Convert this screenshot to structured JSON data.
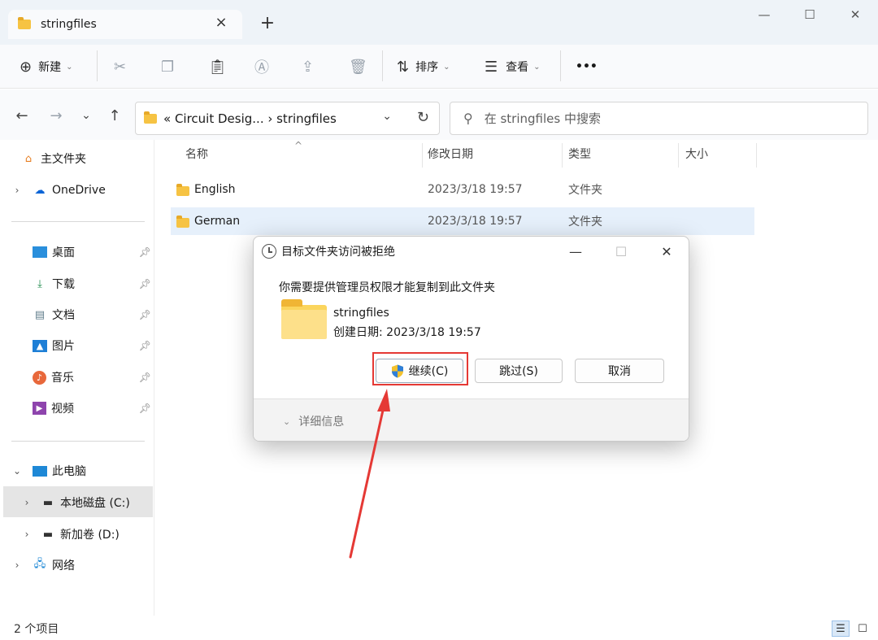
{
  "window": {
    "tab_title": "stringfiles",
    "tab_close": "×",
    "new_tab": "+",
    "controls": {
      "minimize": "—",
      "maximize": "☐",
      "close": "✕"
    }
  },
  "toolbar": {
    "new_label": "新建",
    "sort_label": "排序",
    "view_label": "查看",
    "more": "•••",
    "icons": [
      "new-icon",
      "cut-icon",
      "copy-icon",
      "paste-icon",
      "rename-icon",
      "share-icon",
      "delete-icon",
      "sort-icon",
      "view-icon",
      "more-icon"
    ]
  },
  "nav": {
    "back": "←",
    "forward": "→",
    "recent": "⌄",
    "up": "↑",
    "breadcrumb": "« Circuit Desig... › stringfiles",
    "dropdown": "⌄",
    "refresh": "↻",
    "search_placeholder": "在 stringfiles 中搜索"
  },
  "sidebar": {
    "items": [
      {
        "label": "主文件夹"
      },
      {
        "label": "OneDrive"
      },
      {
        "label": "桌面"
      },
      {
        "label": "下载"
      },
      {
        "label": "文档"
      },
      {
        "label": "图片"
      },
      {
        "label": "音乐"
      },
      {
        "label": "视频"
      },
      {
        "label": "此电脑"
      },
      {
        "label": "本地磁盘 (C:)"
      },
      {
        "label": "新加卷 (D:)"
      },
      {
        "label": "网络"
      }
    ]
  },
  "columns": {
    "name": "名称",
    "modified": "修改日期",
    "type": "类型",
    "size": "大小"
  },
  "files": [
    {
      "name": "English",
      "modified": "2023/3/18 19:57",
      "type": "文件夹"
    },
    {
      "name": "German",
      "modified": "2023/3/18 19:57",
      "type": "文件夹"
    }
  ],
  "status": {
    "count": "2 个项目"
  },
  "dialog": {
    "title": "目标文件夹访问被拒绝",
    "message": "你需要提供管理员权限才能复制到此文件夹",
    "folder_name": "stringfiles",
    "folder_created": "创建日期: 2023/3/18 19:57",
    "continue_label": "继续(C)",
    "skip_label": "跳过(S)",
    "cancel_label": "取消",
    "details_label": "详细信息",
    "controls": {
      "minimize": "—",
      "maximize": "☐",
      "close": "✕"
    }
  },
  "colors": {
    "accent": "#0067c0",
    "selection": "#e6f0fb",
    "highlight": "#e53935",
    "folder": "#f6c343"
  }
}
